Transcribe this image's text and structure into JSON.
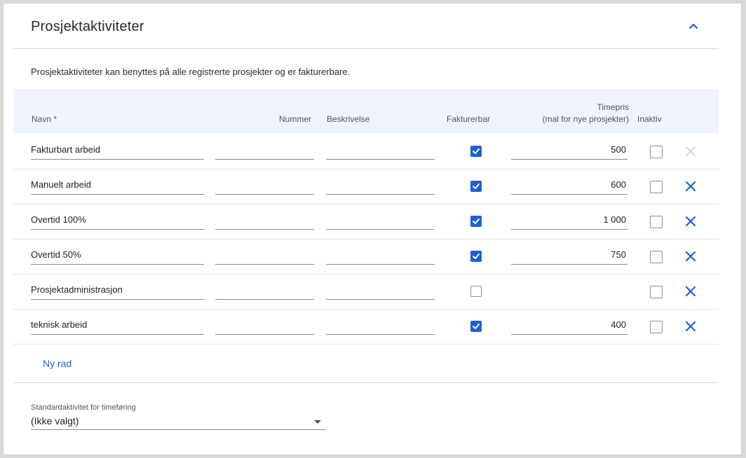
{
  "section": {
    "title": "Prosjektaktiviteter",
    "description": "Prosjektaktiviteter kan benyttes på alle registrerte prosjekter og er fakturerbare."
  },
  "columns": {
    "navn": "Navn *",
    "nummer": "Nummer",
    "beskrivelse": "Beskrivelse",
    "fakturerbar": "Fakturerbar",
    "timepris_line1": "Timepris",
    "timepris_line2": "(mal for nye prosjekter)",
    "inaktiv": "Inaktiv"
  },
  "rows": [
    {
      "navn": "Fakturbart arbeid",
      "nummer": "",
      "beskrivelse": "",
      "fakturerbar": true,
      "timepris": "500",
      "inaktiv": false,
      "delete_enabled": false
    },
    {
      "navn": "Manuelt arbeid",
      "nummer": "",
      "beskrivelse": "",
      "fakturerbar": true,
      "timepris": "600",
      "inaktiv": false,
      "delete_enabled": true
    },
    {
      "navn": "Overtid 100%",
      "nummer": "",
      "beskrivelse": "",
      "fakturerbar": true,
      "timepris": "1 000",
      "inaktiv": false,
      "delete_enabled": true
    },
    {
      "navn": "Overtid 50%",
      "nummer": "",
      "beskrivelse": "",
      "fakturerbar": true,
      "timepris": "750",
      "inaktiv": false,
      "delete_enabled": true
    },
    {
      "navn": "Prosjektadministrasjon",
      "nummer": "",
      "beskrivelse": "",
      "fakturerbar": false,
      "timepris": "",
      "inaktiv": false,
      "delete_enabled": true
    },
    {
      "navn": "teknisk arbeid",
      "nummer": "",
      "beskrivelse": "",
      "fakturerbar": true,
      "timepris": "400",
      "inaktiv": false,
      "delete_enabled": true
    }
  ],
  "add_row_label": "Ny rad",
  "default_activity": {
    "label": "Standardaktivitet for timeføring",
    "value": "(Ikke valgt)"
  },
  "icons": {
    "collapse": "chevron-up-icon",
    "checked": "checkmark-icon",
    "delete": "close-icon",
    "dropdown": "caret-down-icon"
  },
  "colors": {
    "accent": "#1f5fd6",
    "header_bg": "#eef3fc",
    "delete_disabled": "#c8c8c8"
  }
}
